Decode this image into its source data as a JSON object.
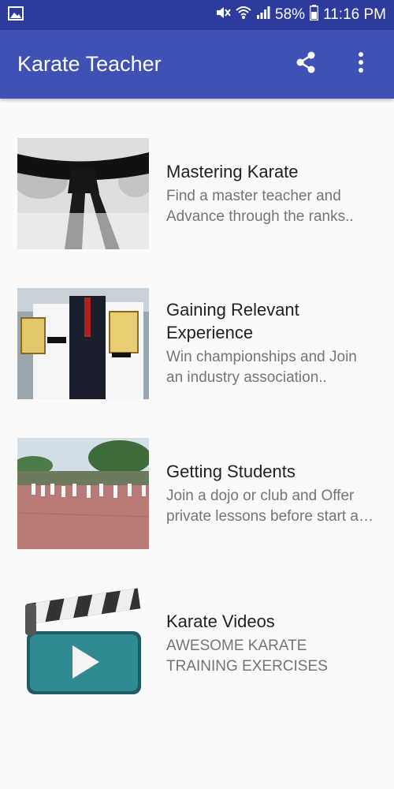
{
  "status": {
    "battery": "58%",
    "time": "11:16 PM"
  },
  "appbar": {
    "title": "Karate Teacher",
    "share_icon": "share-icon",
    "menu_icon": "more-vert-icon"
  },
  "items": [
    {
      "title": "Mastering Karate",
      "description": "Find a master teacher and Advance through the ranks.."
    },
    {
      "title": "Gaining Relevant Experience",
      "description": "Win championships and Join an industry association.."
    },
    {
      "title": "Getting Students",
      "description": "Join a dojo or club and Offer private lessons before start a…"
    },
    {
      "title": "Karate Videos",
      "description": "AWESOME KARATE TRAINING EXERCISES"
    }
  ],
  "colors": {
    "status_bar": "#2e3b9c",
    "app_bar": "#3f51b5",
    "background": "#fafafa",
    "description_text": "#757575"
  }
}
